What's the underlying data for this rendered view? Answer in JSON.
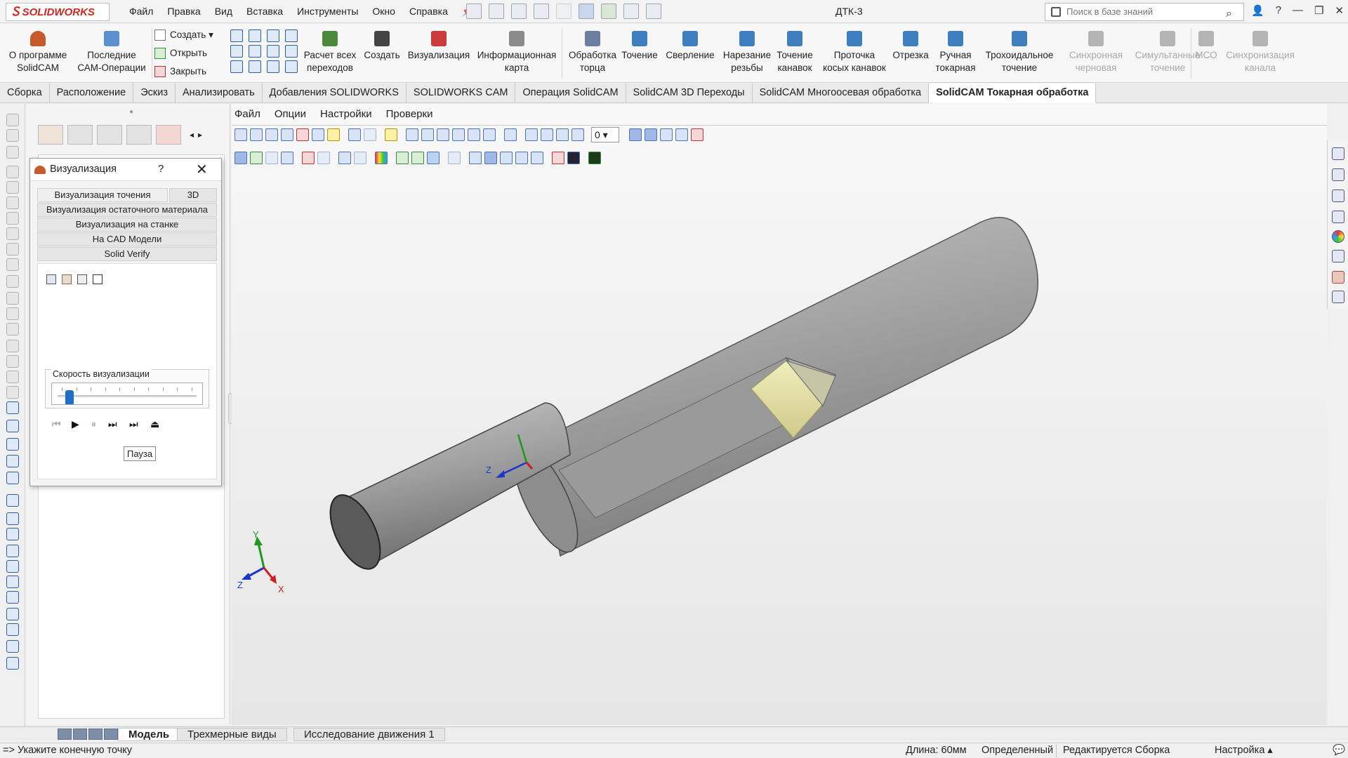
{
  "app": {
    "brand": "SOLIDWORKS",
    "document_title": "ДТК-3",
    "menu": [
      "Файл",
      "Правка",
      "Вид",
      "Вставка",
      "Инструменты",
      "Окно",
      "Справка"
    ],
    "search_placeholder": "Поиск в базе знаний",
    "window_controls": [
      "?",
      "—",
      "❐",
      "✕"
    ]
  },
  "ribbon": {
    "about": "О программе SolidCAM",
    "recent_ops": "Последние САМ-Операции",
    "small_cmds": [
      "Создать",
      "Открыть",
      "Закрыть"
    ],
    "buttons": [
      {
        "label": "Расчет всех переходов",
        "enabled": true,
        "color": "#4a8a3a"
      },
      {
        "label": "Создать",
        "enabled": true,
        "color": "#444444"
      },
      {
        "label": "Визуализация",
        "enabled": true,
        "color": "#cc3b3b"
      },
      {
        "label": "Информационная карта",
        "enabled": true,
        "color": "#8a8a8a"
      },
      {
        "label": "Обработка торца",
        "enabled": true,
        "color": "#6b7fa0"
      },
      {
        "label": "Точение",
        "enabled": true,
        "color": "#3f7fc0"
      },
      {
        "label": "Сверление",
        "enabled": true,
        "color": "#3f7fc0"
      },
      {
        "label": "Нарезание резьбы",
        "enabled": true,
        "color": "#3f7fc0"
      },
      {
        "label": "Точение канавок",
        "enabled": true,
        "color": "#3f7fc0"
      },
      {
        "label": "Проточка косых канавок",
        "enabled": true,
        "color": "#3f7fc0"
      },
      {
        "label": "Отрезка",
        "enabled": true,
        "color": "#3f7fc0"
      },
      {
        "label": "Ручная токарная",
        "enabled": true,
        "color": "#3f7fc0"
      },
      {
        "label": "Трохоидальное точение",
        "enabled": true,
        "color": "#3f7fc0"
      },
      {
        "label": "Синхронная черновая",
        "enabled": false,
        "color": "#b4b4b4"
      },
      {
        "label": "Симультанные точение",
        "enabled": false,
        "color": "#b4b4b4"
      },
      {
        "label": "МСО",
        "enabled": false,
        "color": "#b4b4b4"
      },
      {
        "label": "Синхронизация канала",
        "enabled": false,
        "color": "#b4b4b4"
      }
    ]
  },
  "command_tabs": [
    {
      "label": "Сборка",
      "active": false
    },
    {
      "label": "Расположение",
      "active": false
    },
    {
      "label": "Эскиз",
      "active": false
    },
    {
      "label": "Анализировать",
      "active": false
    },
    {
      "label": "Добавления SOLIDWORKS",
      "active": false
    },
    {
      "label": "SOLIDWORKS CAM",
      "active": false
    },
    {
      "label": "Операция SolidCAM",
      "active": false
    },
    {
      "label": "SolidCAM 3D Переходы",
      "active": false
    },
    {
      "label": "SolidCAM Многоосевая обработка",
      "active": false
    },
    {
      "label": "SolidCAM Токарная обработка",
      "active": true
    }
  ],
  "viz_dialog": {
    "title": "Визуализация",
    "help": "?",
    "close": "✕",
    "tab_turning": "Визуализация точения",
    "tab_3d": "3D",
    "rest_material": "Визуализация остаточного материала",
    "on_machine": "Визуализация на станке",
    "on_cad": "На  CAD Модели",
    "solid_verify": "Solid Verify",
    "speed_label": "Скорость визуализации",
    "speed_value": 0.06,
    "tooltip": "Пауза"
  },
  "graphics": {
    "menu": [
      "Файл",
      "Опции",
      "Настройки",
      "Проверки"
    ],
    "zoom_value": "0",
    "triad_labels": {
      "x": "X",
      "y": "Y",
      "z": "Z"
    },
    "colors": {
      "stock": "#9a9a9a",
      "tool": "#e3df9c",
      "x_axis": "#d01c1c",
      "y_axis": "#1b9a1b",
      "z_axis": "#1c36c8"
    }
  },
  "bottom_tabs": [
    {
      "label": "Модель",
      "active": true
    },
    {
      "label": "Трехмерные виды",
      "active": false
    },
    {
      "label": "Исследование движения 1",
      "active": false
    }
  ],
  "status": {
    "prompt": "=> Укажите конечную точку",
    "length": "Длина: 60мм",
    "state": "Определенный",
    "editing": "Редактируется Сборка",
    "settings": "Настройка"
  }
}
